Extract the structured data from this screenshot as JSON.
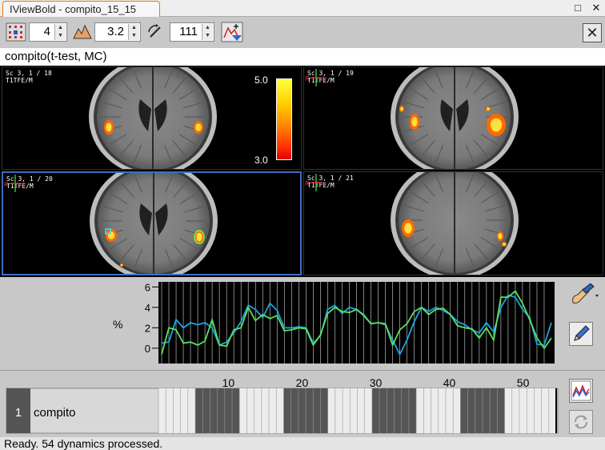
{
  "window": {
    "title": "IViewBold - compito_15_15",
    "minimize": "□",
    "close": "✕"
  },
  "toolbar": {
    "cluster_value": "4",
    "threshold_value": "3.2",
    "slice_value": "111",
    "close_label": "✕",
    "icons": [
      "cluster-grid-icon",
      "threshold-histogram-icon",
      "slice-rotate-icon",
      "add-overlay-icon",
      "close-icon"
    ]
  },
  "image_title": "compito(t-test, MC)",
  "viewports": [
    {
      "label": "Sc 3, 1 / 18\nT1TFE/M"
    },
    {
      "label": "Sc 3, 1 / 19\nT1TFE/M"
    },
    {
      "label": "Sc 3, 1 / 20\nT1TFE/M"
    },
    {
      "label": "Sc 3, 1 / 21\nT1TFE/M"
    }
  ],
  "colorbar": {
    "max": "5.0",
    "min": "3.0"
  },
  "orientation": {
    "right": "R",
    "left": "L"
  },
  "timecourse": {
    "ylabel": "%",
    "yticks": [
      "6",
      "4",
      "2",
      "0"
    ],
    "ylim": [
      -1.5,
      6.5
    ],
    "n": 54,
    "series": [
      {
        "color": "#1aa6e6",
        "values": [
          0.5,
          0.6,
          2.8,
          2.0,
          2.5,
          2.3,
          2.5,
          2.0,
          0.3,
          0.6,
          1.5,
          2.6,
          4.2,
          3.8,
          3.0,
          4.4,
          3.7,
          2.0,
          2.0,
          2.1,
          2.0,
          0.5,
          1.2,
          3.8,
          4.2,
          3.4,
          4.0,
          3.8,
          3.3,
          2.4,
          2.5,
          2.3,
          0.8,
          -0.6,
          0.8,
          2.6,
          4.0,
          3.6,
          4.0,
          3.7,
          3.3,
          2.6,
          2.3,
          1.8,
          1.5,
          2.5,
          1.6,
          4.0,
          5.2,
          5.0,
          3.8,
          3.0,
          0.4,
          0.3,
          2.5
        ]
      },
      {
        "color": "#5de05d",
        "values": [
          -0.6,
          2.0,
          1.8,
          0.5,
          0.6,
          0.3,
          0.7,
          2.8,
          0.3,
          0.2,
          1.8,
          2.0,
          4.0,
          2.7,
          3.3,
          2.9,
          3.2,
          1.7,
          1.8,
          2.0,
          1.9,
          0.3,
          1.3,
          3.4,
          4.0,
          3.6,
          3.5,
          3.8,
          3.2,
          2.4,
          2.5,
          2.4,
          0.3,
          1.8,
          2.4,
          3.6,
          4.0,
          3.3,
          3.8,
          3.9,
          3.3,
          2.2,
          2.0,
          1.9,
          1.0,
          2.0,
          0.8,
          5.0,
          5.0,
          5.6,
          4.4,
          2.8,
          1.0,
          0.0,
          1.0
        ]
      }
    ]
  },
  "timeline": {
    "ticks": [
      "10",
      "20",
      "30",
      "40",
      "50"
    ],
    "condition_number": "1",
    "condition_name": "compito",
    "blocks": [
      [
        6,
        11
      ],
      [
        18,
        23
      ],
      [
        30,
        35
      ],
      [
        42,
        47
      ]
    ],
    "n": 54
  },
  "status": "Ready. 54 dynamics processed."
}
